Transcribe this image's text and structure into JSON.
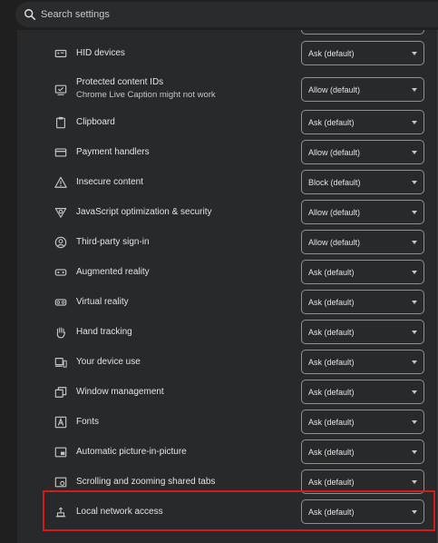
{
  "search": {
    "placeholder": "Search settings"
  },
  "rows": [
    {
      "label": "HID devices",
      "value": "Ask (default)",
      "icon": "hid-devices-icon"
    },
    {
      "label": "Protected content IDs",
      "sublabel": "Chrome Live Caption might not work",
      "value": "Allow (default)",
      "icon": "protected-content-icon"
    },
    {
      "label": "Clipboard",
      "value": "Ask (default)",
      "icon": "clipboard-icon"
    },
    {
      "label": "Payment handlers",
      "value": "Allow (default)",
      "icon": "payment-card-icon"
    },
    {
      "label": "Insecure content",
      "value": "Block (default)",
      "icon": "warning-triangle-icon"
    },
    {
      "label": "JavaScript optimization & security",
      "value": "Allow (default)",
      "icon": "v8-shield-icon"
    },
    {
      "label": "Third-party sign-in",
      "value": "Allow (default)",
      "icon": "account-circle-icon"
    },
    {
      "label": "Augmented reality",
      "value": "Ask (default)",
      "icon": "ar-headset-icon"
    },
    {
      "label": "Virtual reality",
      "value": "Ask (default)",
      "icon": "vr-headset-icon"
    },
    {
      "label": "Hand tracking",
      "value": "Ask (default)",
      "icon": "hand-icon"
    },
    {
      "label": "Your device use",
      "value": "Ask (default)",
      "icon": "devices-icon"
    },
    {
      "label": "Window management",
      "value": "Ask (default)",
      "icon": "window-management-icon"
    },
    {
      "label": "Fonts",
      "value": "Ask (default)",
      "icon": "font-icon"
    },
    {
      "label": "Automatic picture-in-picture",
      "value": "Ask (default)",
      "icon": "picture-in-picture-icon"
    },
    {
      "label": "Scrolling and zooming shared tabs",
      "value": "Ask (default)",
      "icon": "scroll-zoom-tab-icon"
    },
    {
      "label": "Local network access",
      "value": "Ask (default)",
      "icon": "local-network-icon"
    }
  ],
  "colors": {
    "highlight": "#d21b1b",
    "panel": "#28292b",
    "background": "#1f1f1f"
  }
}
